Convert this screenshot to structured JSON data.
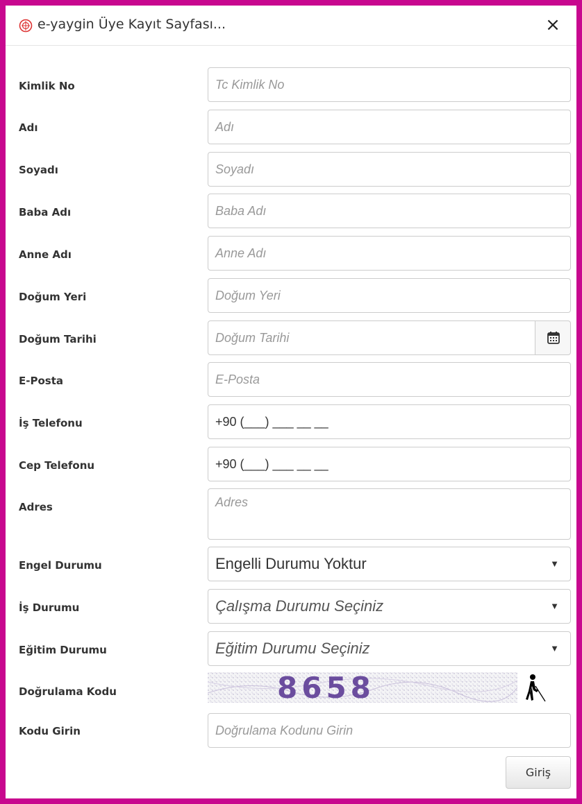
{
  "modal": {
    "title": "e-yaygin Üye Kayıt Sayfası...",
    "close_label": "×"
  },
  "form": {
    "kimlik": {
      "label": "Kimlik No",
      "placeholder": "Tc Kimlik No"
    },
    "adi": {
      "label": "Adı",
      "placeholder": "Adı"
    },
    "soyadi": {
      "label": "Soyadı",
      "placeholder": "Soyadı"
    },
    "baba": {
      "label": "Baba Adı",
      "placeholder": "Baba Adı"
    },
    "anne": {
      "label": "Anne Adı",
      "placeholder": "Anne Adı"
    },
    "dogum_yeri": {
      "label": "Doğum Yeri",
      "placeholder": "Doğum Yeri"
    },
    "dogum_tarihi": {
      "label": "Doğum Tarihi",
      "placeholder": "Doğum Tarihi",
      "icon": "calendar-icon"
    },
    "eposta": {
      "label": "E-Posta",
      "placeholder": "E-Posta"
    },
    "is_tel": {
      "label": "İş Telefonu",
      "value": "+90 (___) ___ __ __"
    },
    "cep_tel": {
      "label": "Cep Telefonu",
      "value": "+90 (___) ___ __ __"
    },
    "adres": {
      "label": "Adres",
      "placeholder": "Adres"
    },
    "engel": {
      "label": "Engel Durumu",
      "selected": "Engelli Durumu Yoktur"
    },
    "is_durumu": {
      "label": "İş Durumu",
      "selected": "Çalışma Durumu Seçiniz"
    },
    "egitim": {
      "label": "Eğitim Durumu",
      "selected": "Eğitim Durumu Seçiniz"
    },
    "dogrulama": {
      "label": "Doğrulama Kodu",
      "captcha_text": "8658",
      "icon": "accessibility-icon"
    },
    "kod": {
      "label": "Kodu Girin",
      "placeholder": "Doğrulama Kodunu Girin"
    },
    "submit_label": "Giriş",
    "select_arrow": "▼"
  },
  "colors": {
    "frame": "#c8088f",
    "captcha_text": "#6b4d9e"
  }
}
